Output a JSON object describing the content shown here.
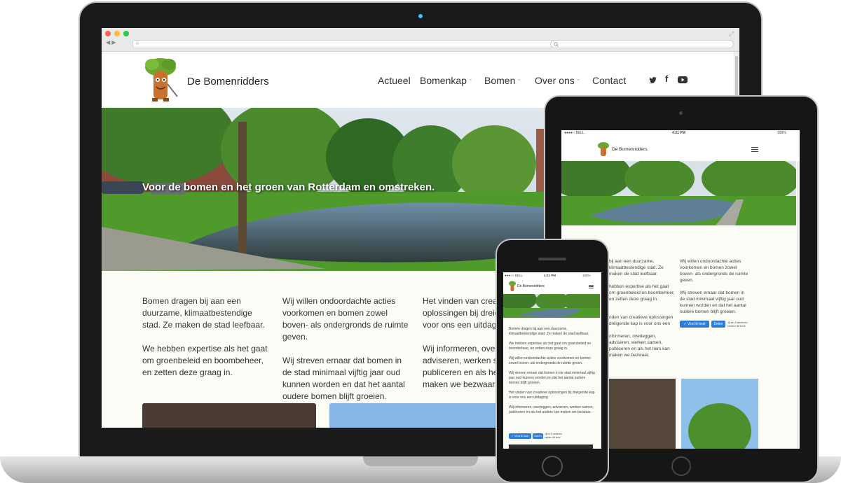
{
  "site": {
    "logo_text": "De Bomenridders",
    "nav": [
      {
        "label": "Actueel"
      },
      {
        "label": "Bomenkap"
      },
      {
        "label": "Bomen"
      },
      {
        "label": "Over ons"
      },
      {
        "label": "Contact"
      }
    ],
    "dropdown_indicator": "ˇ",
    "hero_caption": "Voor de bomen en het groen van Rotterdam en omstreken.",
    "col1": [
      "Bomen dragen bij aan een duurzame, klimaatbestendige stad. Ze maken de stad leefbaar.",
      "We hebben expertise als het gaat om groenbeleid en boombeheer, en zetten deze graag in."
    ],
    "col2": [
      "Wij willen ondoordachte acties voorkomen en bomen zowel boven- als ondergronds de ruimte geven.",
      "Wij streven ernaar dat bomen in de stad minimaal vijftig jaar oud kunnen worden en dat het aantal oudere bomen blijft groeien."
    ],
    "col3": [
      "Het vinden van creatie",
      "oplossingen bij dreige",
      "voor ons een uitdagin",
      "Wij informeren, overle",
      "adviseren, werken sa",
      "publiceren en als het",
      "maken we bezwaar."
    ],
    "social_icons": [
      "twitter-icon",
      "facebook-icon",
      "youtube-icon"
    ]
  },
  "tablet": {
    "status_carrier": "●●●●○ BELL",
    "status_time": "4:21 PM",
    "status_battery": "100%",
    "logo_text": "De Bomenridders",
    "col_left": [
      "bij aan een duurzame, klimaatbestendige stad. Ze maken de stad leefbaar.",
      "hebben expertise als het gaat om groenbeleid en boombeheer, en zetten deze graag in."
    ],
    "col_right": [
      "Wij willen ondoordachte acties voorkomen en bomen zowel boven- als ondergronds de ruimte geven.",
      "Wij streven ernaar dat bomen in de stad minimaal vijftig jaar oud kunnen worden en dat het aantal oudere bomen blijft groeien."
    ],
    "col_mid": [
      "nden van creatieve oplossingen dreigende kap is voor ons een",
      "nformeren, overleggen, adviseren, werken samen, publiceren en als het ners kan maken we bezwaar."
    ],
    "like_label": "✓ Vind ik leuk",
    "share_label": "Delen",
    "like_count": "Jij en 6 anderen vinden dit leuk"
  },
  "phone": {
    "status_carrier": "●●●○○ BELL",
    "status_time": "4:21 PM",
    "status_battery": "100%",
    "logo_text": "De Bomenridders",
    "paragraphs": [
      "Bomen dragen bij aan een duurzame, klimaatbestendige stad. Ze maken de stad leefbaar.",
      "We hebben expertise als het gaat om groenbeleid en boombeheer, en zetten deze graag in.",
      "Wij willen ondoordachte acties voorkomen en bomen zowel boven- als ondergronds de ruimte geven.",
      "Wij streven ernaar dat bomen in de stad minimaal vijftig jaar oud kunnen worden en dat het aantal oudere bomen blijft groeien.",
      "Het vinden van creatieve oplossingen bij dreigende kap is voor ons een uitdaging.",
      "Wij informeren, overleggen, adviseren, werken samen, publiceren en als het anders kan maken we bezwaar."
    ],
    "like_label": "✓ Vind ik leuk",
    "share_label": "Delen",
    "like_count": "Jij en 6 anderen vinden dit leuk"
  }
}
